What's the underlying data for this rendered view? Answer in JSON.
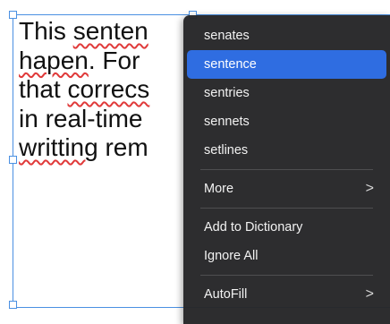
{
  "document": {
    "lines": [
      [
        {
          "text": "This ",
          "misspelled": false
        },
        {
          "text": "senten",
          "misspelled": true
        }
      ],
      [
        {
          "text": "hapen",
          "misspelled": true
        },
        {
          "text": ". For",
          "misspelled": false
        }
      ],
      [
        {
          "text": "that ",
          "misspelled": false
        },
        {
          "text": "correcs",
          "misspelled": true
        }
      ],
      [
        {
          "text": "in real-time",
          "misspelled": false
        }
      ],
      [
        {
          "text": "writting",
          "misspelled": true
        },
        {
          "text": " rem",
          "misspelled": false
        }
      ]
    ]
  },
  "context_menu": {
    "suggestions": [
      {
        "label": "senates",
        "selected": false
      },
      {
        "label": "sentence",
        "selected": true
      },
      {
        "label": "sentries",
        "selected": false
      },
      {
        "label": "sennets",
        "selected": false
      },
      {
        "label": "setlines",
        "selected": false
      }
    ],
    "more_label": "More",
    "add_to_dictionary_label": "Add to Dictionary",
    "ignore_all_label": "Ignore All",
    "autofill_label": "AutoFill",
    "submenu_chevron": ">"
  },
  "colors": {
    "selection_frame": "#4a90e2",
    "spell_underline": "#e03a3a",
    "menu_background": "#262628",
    "menu_highlight": "#2f6de1"
  }
}
